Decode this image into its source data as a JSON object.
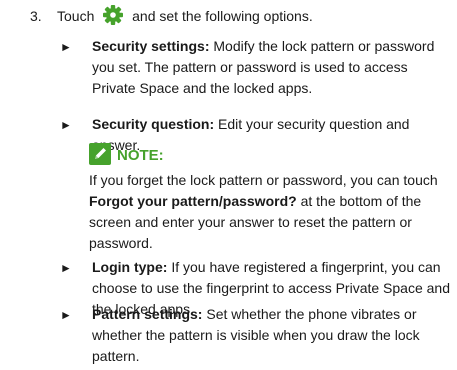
{
  "step": {
    "number": "3.",
    "before_icon": "Touch",
    "icon": "gear-icon",
    "after_icon": "and set the following options."
  },
  "bullets": [
    {
      "term": "Security settings:",
      "text": "Modify the lock pattern or password you set. The pattern or password is used to access Private Space and the locked apps."
    },
    {
      "term": "Security question:",
      "text": "Edit your security question and answer."
    },
    {
      "term": "Login type:",
      "text": "If you have registered a fingerprint, you can choose to use the fingerprint to access Private Space and the locked apps."
    },
    {
      "term": "Pattern settings:",
      "text": "Set whether the phone vibrates or whether the pattern is visible when you draw the lock pattern."
    }
  ],
  "note": {
    "icon": "pencil-note-icon",
    "label": "NOTE:",
    "text_before": "If you forget the lock pattern or password, you can touch",
    "bold_text": "Forgot your pattern/password?",
    "text_after": "at the bottom of the screen and enter your answer to reset the pattern or password."
  },
  "colors": {
    "accent_green": "#46a22c",
    "text": "#1a1a1a"
  },
  "bullet_glyph": "►"
}
